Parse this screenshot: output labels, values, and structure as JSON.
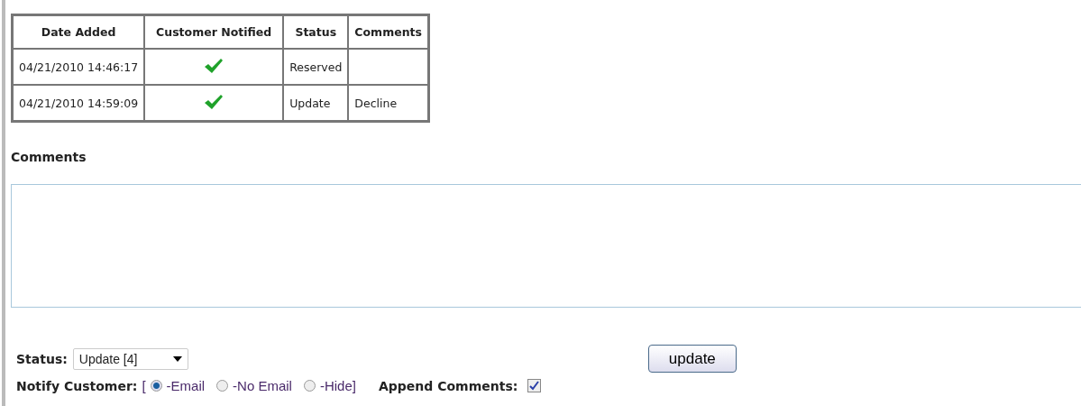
{
  "history": {
    "columns": [
      "Date Added",
      "Customer Notified",
      "Status",
      "Comments"
    ],
    "rows": [
      {
        "date": "04/21/2010 14:46:17",
        "notified": true,
        "status": "Reserved",
        "comments": ""
      },
      {
        "date": "04/21/2010 14:59:09",
        "notified": true,
        "status": "Update",
        "comments": "Decline"
      }
    ]
  },
  "comments": {
    "label": "Comments"
  },
  "status": {
    "label": "Status:",
    "value": "Update [4]"
  },
  "update_button": "update",
  "notify": {
    "label": "Notify Customer:",
    "open": "[",
    "options": [
      {
        "label": "-Email",
        "selected": true
      },
      {
        "label": "-No Email",
        "selected": false
      },
      {
        "label": "-Hide]",
        "selected": false
      }
    ]
  },
  "append": {
    "label": "Append Comments:",
    "checked": true
  }
}
